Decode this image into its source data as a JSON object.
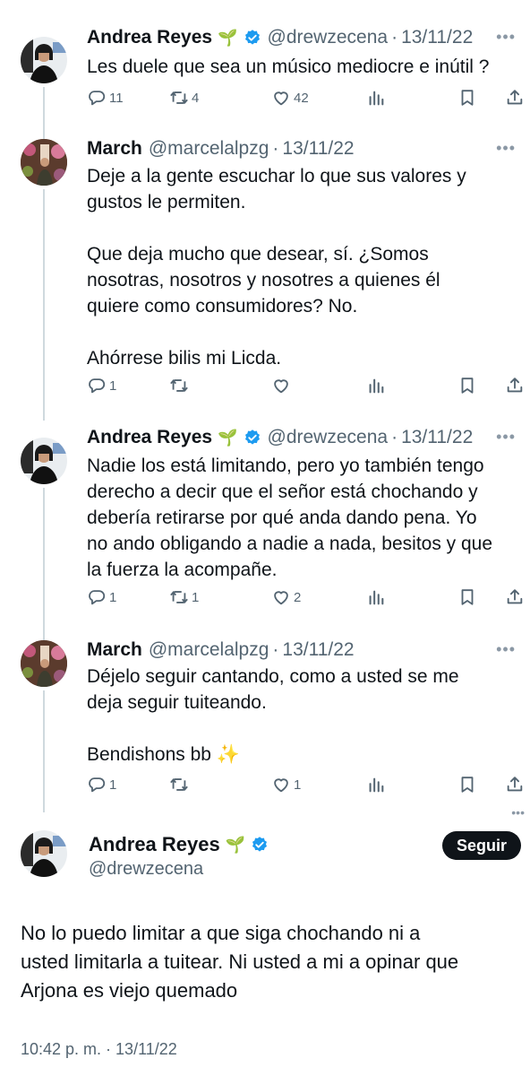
{
  "tweets": [
    {
      "name": "Andrea Reyes",
      "leaf": "🌱",
      "handle": "@drewzecena",
      "date": "13/11/22",
      "lines": [
        "Les duele que sea un músico mediocre e inútil ?"
      ],
      "replies": "11",
      "retweets": "4",
      "likes": "42"
    },
    {
      "name": "March",
      "handle": "@marcelalpzg",
      "date": "13/11/22",
      "lines": [
        "Deje a la gente escuchar lo que sus valores y",
        "gustos le permiten.",
        "",
        "Que deja mucho que desear, sí. ¿Somos",
        "nosotras, nosotros y nosotres a quienes él",
        "quiere como consumidores? No.",
        "",
        "Ahórrese bilis mi Licda."
      ],
      "replies": "1",
      "retweets": "",
      "likes": ""
    },
    {
      "name": "Andrea Reyes",
      "leaf": "🌱",
      "handle": "@drewzecena",
      "date": "13/11/22",
      "lines": [
        "Nadie los está limitando, pero yo también tengo",
        "derecho a decir que el señor está chochando y",
        "debería retirarse por qué anda dando pena. Yo",
        "no ando obligando a nadie a nada, besitos y que",
        "la fuerza la acompañe."
      ],
      "replies": "1",
      "retweets": "1",
      "likes": "2"
    },
    {
      "name": "March",
      "handle": "@marcelalpzg",
      "date": "13/11/22",
      "lines": [
        "Déjelo seguir cantando, como a usted se me",
        "deja seguir tuiteando.",
        "",
        "Bendishons bb ✨"
      ],
      "replies": "1",
      "retweets": "",
      "likes": "1"
    }
  ],
  "main": {
    "name": "Andrea Reyes",
    "leaf": "🌱",
    "handle": "@drewzecena",
    "follow_label": "Seguir",
    "lines": [
      "No lo puedo limitar a que siga chochando ni a",
      "usted limitarla a tuitear. Ni usted a mi a opinar que",
      "Arjona es viejo quemado"
    ],
    "timestamp": "10:42 p. m. · 13/11/22"
  },
  "icons": {
    "reply": "reply-icon",
    "retweet": "retweet-icon",
    "like": "heart-icon",
    "views": "views-icon",
    "bookmark": "bookmark-icon",
    "share": "share-icon",
    "verified": "verified-badge-icon",
    "more": "more-icon"
  },
  "colors": {
    "text": "#0f1419",
    "secondary": "#536471",
    "verified": "#1d9bf0",
    "thread_line": "#cfd9de",
    "follow_bg": "#0f1419"
  }
}
